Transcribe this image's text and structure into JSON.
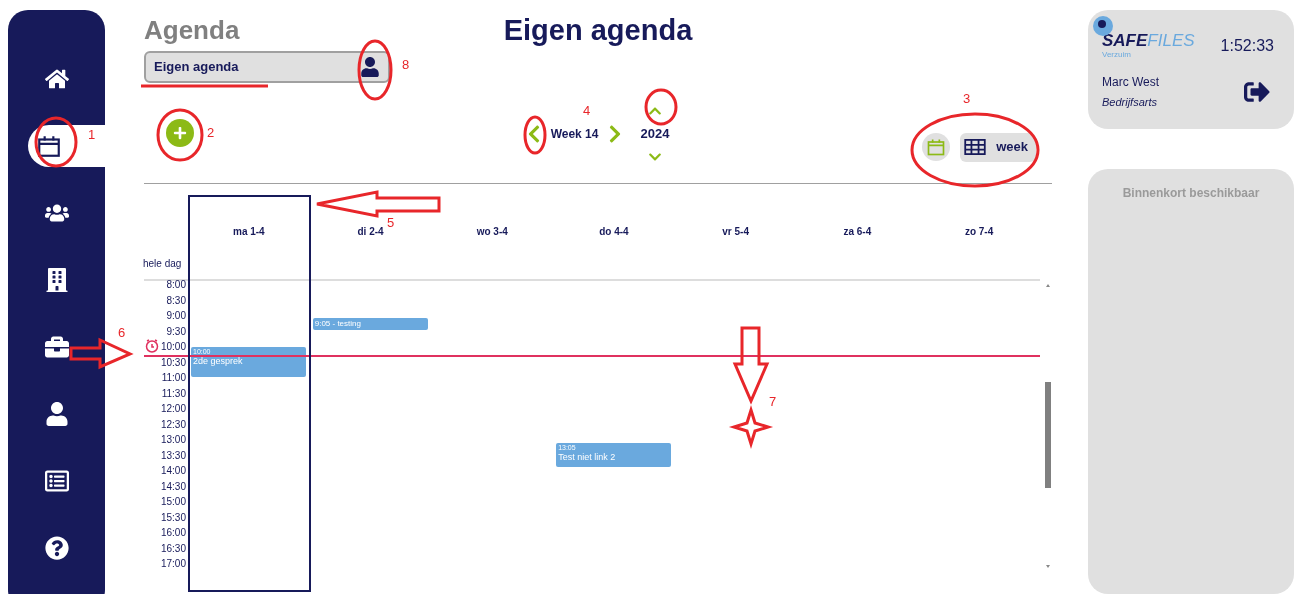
{
  "sidebar": {
    "items": [
      {
        "selected": false
      },
      {
        "selected": true
      },
      {
        "selected": false
      },
      {
        "selected": false
      },
      {
        "selected": false
      },
      {
        "selected": false
      },
      {
        "selected": false
      },
      {
        "selected": false
      }
    ]
  },
  "header": {
    "section": "Agenda",
    "title": "Eigen agenda",
    "agenda_field": {
      "value": "Eigen agenda"
    }
  },
  "navigation": {
    "week": "Week 14",
    "year": "2024"
  },
  "view_buttons": [
    {
      "kind": "calendar"
    },
    {
      "kind": "grid",
      "label": "week"
    }
  ],
  "calendar": {
    "all_day_label": "hele dag",
    "days": [
      {
        "label": "ma 1-4",
        "outlined": true,
        "events": [
          {
            "kind": "full",
            "time": "10:00",
            "title": "2de gesprek"
          }
        ]
      },
      {
        "label": "di 2-4",
        "outlined": false,
        "events": [
          {
            "kind": "compact",
            "title": "9:05 - testing"
          }
        ]
      },
      {
        "label": "wo 3-4",
        "outlined": false
      },
      {
        "label": "do 4-4",
        "outlined": false,
        "events": [
          {
            "kind": "full",
            "time": "13:05",
            "title": "Test niet link 2"
          }
        ]
      },
      {
        "label": "vr 5-4",
        "outlined": false
      },
      {
        "label": "za 6-4",
        "outlined": false
      },
      {
        "label": "zo 7-4",
        "outlined": false
      }
    ],
    "times": [
      "8:00",
      "8:30",
      "9:00",
      "9:30",
      "10:00",
      "10:30",
      "11:00",
      "11:30",
      "12:00",
      "12:30",
      "13:00",
      "13:30",
      "14:00",
      "14:30",
      "15:00",
      "15:30",
      "16:00",
      "16:30",
      "17:00"
    ]
  },
  "account": {
    "logo_part_1": "SAFE",
    "logo_part_2": "FILES",
    "logo_tagline": "Verzuim",
    "clock": "1:52:33",
    "name": "Marc West",
    "role": "Bedrijfsarts"
  },
  "side_panel": {
    "message": "Binnenkort beschikbaar"
  },
  "annotations": [
    "1",
    "2",
    "3",
    "4",
    "5",
    "6",
    "7",
    "8"
  ]
}
